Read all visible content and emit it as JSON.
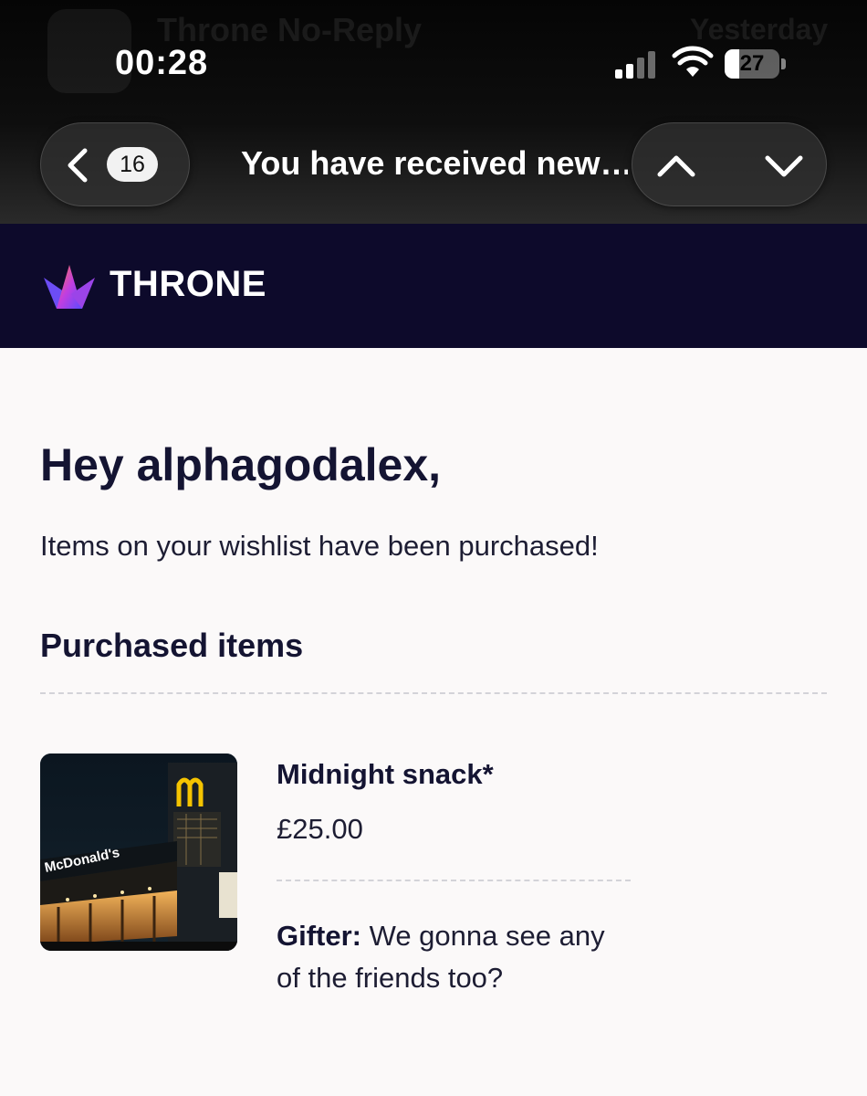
{
  "status_bar": {
    "time": "00:28",
    "battery_level": "27",
    "battery_fraction": 0.27,
    "signal_bars": 2,
    "icons": [
      "signal-icon",
      "wifi-icon",
      "battery-icon"
    ]
  },
  "background_notification": {
    "sender": "Throne No-Reply",
    "date": "Yesterday"
  },
  "nav": {
    "unread_count": "16",
    "title": "You have received new…",
    "icons": [
      "chevron-left-icon",
      "chevron-up-icon",
      "chevron-down-icon"
    ]
  },
  "brand": {
    "name": "THRONE",
    "background": "#0d0a2b"
  },
  "email": {
    "greeting": "Hey alphagodalex,",
    "intro": "Items on your wishlist have been purchased!",
    "section_title": "Purchased items",
    "items": [
      {
        "name": "Midnight snack*",
        "price": "£25.00",
        "image_sign": "McDonald's",
        "gifter_label": "Gifter:",
        "gifter_message": "We gonna see any of the friends too?"
      }
    ]
  },
  "colors": {
    "heading_text": "#141432",
    "page_background": "#fbf9f9"
  }
}
